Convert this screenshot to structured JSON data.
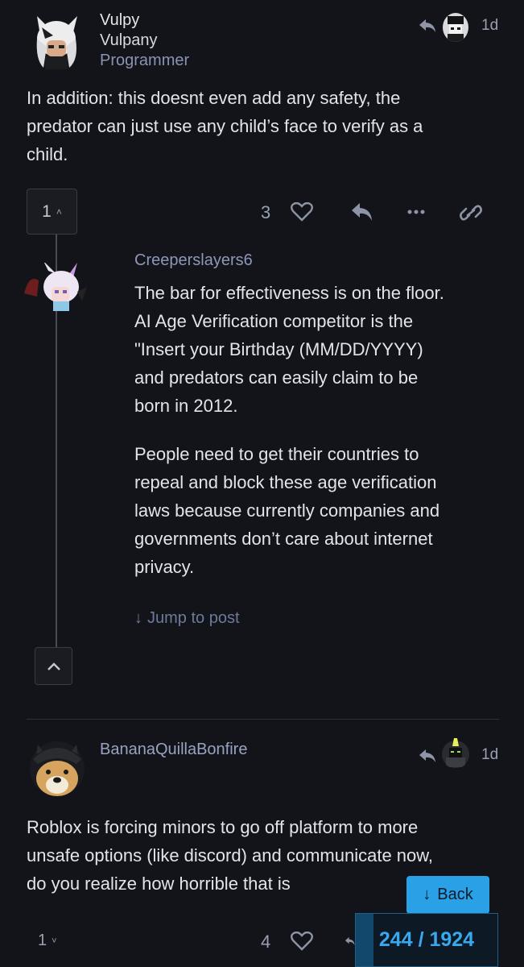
{
  "post1": {
    "username": "Vulpy",
    "display_name": "Vulpany",
    "user_title": "Programmer",
    "date": "1d",
    "body": [
      "In addition: this doesnt even add any safety, the",
      "predator can just use any child’s face to verify as a",
      "child."
    ],
    "replies_count": "1",
    "likes": "3"
  },
  "embedded_reply": {
    "username": "Creeperslayers6",
    "paragraph1": [
      "The bar for effectiveness is on the floor.",
      "AI Age Verification competitor is the",
      "\"Insert your Birthday (MM/DD/YYYY)",
      "and predators can easily claim to be",
      "born in 2012."
    ],
    "paragraph2": [
      "People need to get their countries to",
      "repeal and block these age verification",
      "laws because currently companies and",
      "governments don’t care about internet",
      "privacy."
    ],
    "jump_label": "Jump to post"
  },
  "post2": {
    "username": "BananaQuillaBonfire",
    "date": "1d",
    "body": [
      "Roblox is forcing minors to go off platform to more",
      "unsafe options (like discord) and communicate now,",
      "do you realize how horrible that is"
    ],
    "replies_count": "1",
    "likes": "4"
  },
  "back_button": "Back",
  "progress": "244 / 1924",
  "colors": {
    "accent": "#2aa0e6",
    "background": "#131419",
    "muted": "#7f8aa8"
  }
}
